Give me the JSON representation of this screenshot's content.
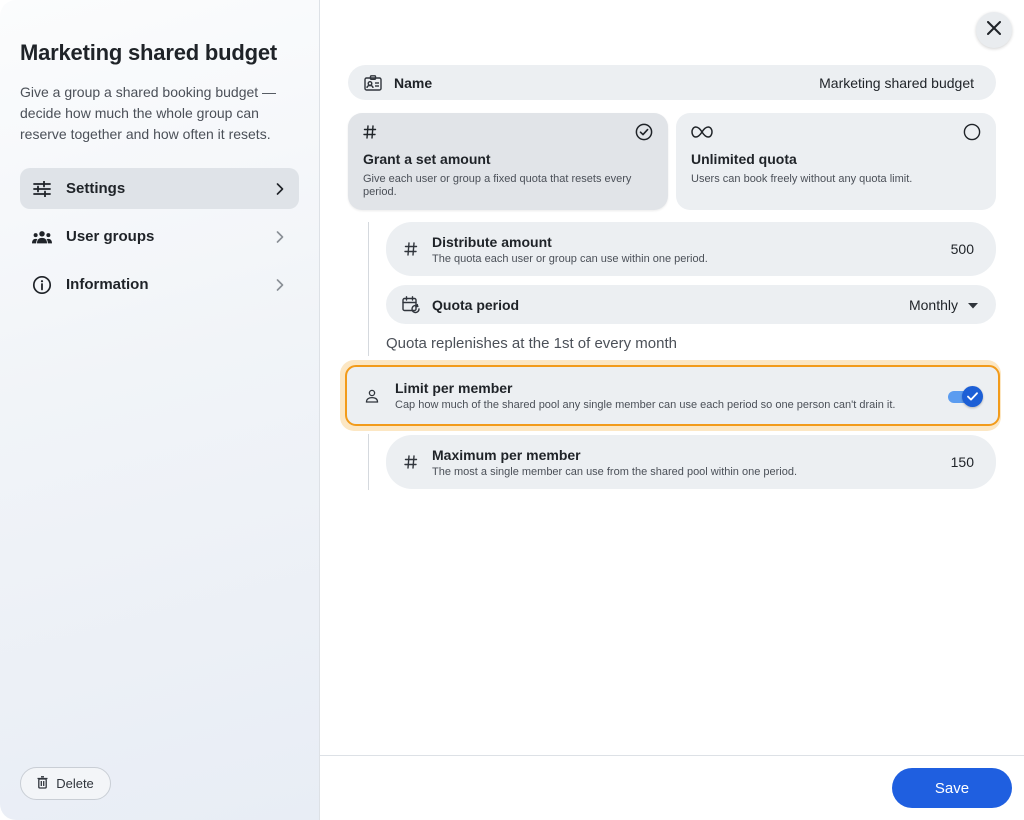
{
  "sidebar": {
    "title": "Marketing shared budget",
    "description": "Give a group a shared booking budget — decide how much the whole group can reserve together and how often it resets.",
    "items": [
      {
        "label": "Settings",
        "icon": "sliders-icon",
        "active": true
      },
      {
        "label": "User groups",
        "icon": "users-icon",
        "active": false
      },
      {
        "label": "Information",
        "icon": "info-icon",
        "active": false
      }
    ],
    "delete_label": "Delete"
  },
  "main": {
    "name": {
      "label": "Name",
      "value": "Marketing shared budget"
    },
    "options": [
      {
        "icon": "hash-icon",
        "title": "Grant a set amount",
        "description": "Give each user or group a fixed quota that resets every period.",
        "selected": true
      },
      {
        "icon": "infinity-icon",
        "title": "Unlimited quota",
        "description": "Users can book freely without any quota limit.",
        "selected": false
      }
    ],
    "distribute": {
      "title": "Distribute amount",
      "description": "The quota each user or group can use within one period.",
      "value": "500"
    },
    "quota_period": {
      "label": "Quota period",
      "value": "Monthly"
    },
    "replenish_note": "Quota replenishes at the 1st of every month",
    "limit_per_member": {
      "title": "Limit per member",
      "description": "Cap how much of the shared pool any single member can use each period so one person can't drain it.",
      "enabled": true
    },
    "maximum": {
      "title": "Maximum per member",
      "description": "The most a single member can use from the shared pool within one period.",
      "value": "150"
    }
  },
  "footer": {
    "save_label": "Save"
  },
  "colors": {
    "accent": "#1f5fe0",
    "highlight": "#f29b1b"
  }
}
